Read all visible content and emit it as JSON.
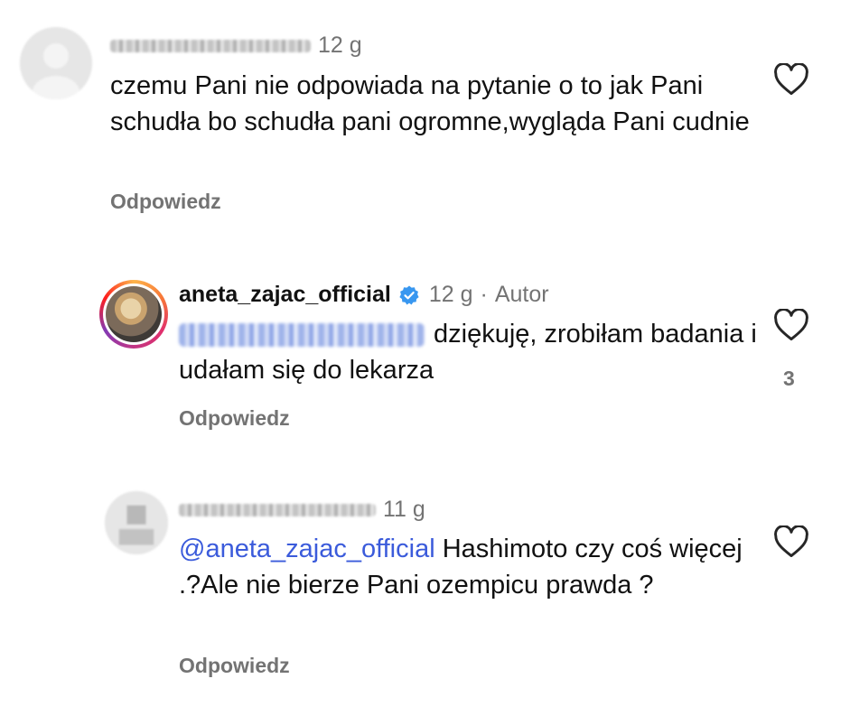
{
  "comments": [
    {
      "username_blurred": true,
      "time": "12 g",
      "text": "czemu Pani nie odpowiada na pytanie o to jak Pani schudła bo schudła pani ogromne,wygląda Pani cudnie",
      "reply_label": "Odpowiedz",
      "avatar": "default-avatar-icon"
    },
    {
      "username": "aneta_zajac_official",
      "verified": true,
      "time": "12 g",
      "separator": "·",
      "author_label": "Autor",
      "mention_blurred": true,
      "text": "dziękuję, zrobiłam badania i udałam się do lekarza",
      "reply_label": "Odpowiedz",
      "likes": "3",
      "avatar": "profile-photo-with-story-ring"
    },
    {
      "username_blurred": true,
      "time": "11 g",
      "mention": "@aneta_zajac_official",
      "text": "Hashimoto czy coś więcej .?Ale nie bierze Pani ozempicu prawda ?",
      "reply_label": "Odpowiedz",
      "avatar": "default-avatar-icon"
    }
  ],
  "colors": {
    "mention": "#3b5bdb",
    "secondary_text": "#737373",
    "verified_badge": "#3897f0"
  }
}
